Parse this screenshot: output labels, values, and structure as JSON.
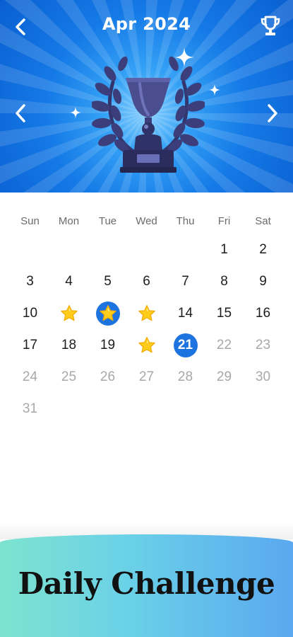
{
  "header": {
    "title": "Apr 2024",
    "back_icon": "chevron-left-icon",
    "trophy_icon": "trophy-icon",
    "prev_icon": "chevron-left-icon",
    "next_icon": "chevron-right-icon"
  },
  "calendar": {
    "weekdays": [
      "Sun",
      "Mon",
      "Tue",
      "Wed",
      "Thu",
      "Fri",
      "Sat"
    ],
    "days": [
      {
        "label": "",
        "state": "blank"
      },
      {
        "label": "",
        "state": "blank"
      },
      {
        "label": "",
        "state": "blank"
      },
      {
        "label": "",
        "state": "blank"
      },
      {
        "label": "",
        "state": "blank"
      },
      {
        "label": "1",
        "state": "normal"
      },
      {
        "label": "2",
        "state": "normal"
      },
      {
        "label": "3",
        "state": "normal"
      },
      {
        "label": "4",
        "state": "normal"
      },
      {
        "label": "5",
        "state": "normal"
      },
      {
        "label": "6",
        "state": "normal"
      },
      {
        "label": "7",
        "state": "normal"
      },
      {
        "label": "8",
        "state": "normal"
      },
      {
        "label": "9",
        "state": "normal"
      },
      {
        "label": "10",
        "state": "normal"
      },
      {
        "label": "",
        "state": "star"
      },
      {
        "label": "",
        "state": "star-selected"
      },
      {
        "label": "",
        "state": "star"
      },
      {
        "label": "14",
        "state": "normal"
      },
      {
        "label": "15",
        "state": "normal"
      },
      {
        "label": "16",
        "state": "normal"
      },
      {
        "label": "17",
        "state": "normal"
      },
      {
        "label": "18",
        "state": "normal"
      },
      {
        "label": "19",
        "state": "normal"
      },
      {
        "label": "",
        "state": "star"
      },
      {
        "label": "21",
        "state": "today"
      },
      {
        "label": "22",
        "state": "future"
      },
      {
        "label": "23",
        "state": "future"
      },
      {
        "label": "24",
        "state": "future"
      },
      {
        "label": "25",
        "state": "future"
      },
      {
        "label": "26",
        "state": "future"
      },
      {
        "label": "27",
        "state": "future"
      },
      {
        "label": "28",
        "state": "future"
      },
      {
        "label": "29",
        "state": "future"
      },
      {
        "label": "30",
        "state": "future"
      },
      {
        "label": "31",
        "state": "future"
      }
    ],
    "colors": {
      "accent": "#1d73e0",
      "star": "#ffcc1a",
      "future": "#a8a8a8"
    }
  },
  "banner": {
    "title": "Daily Challenge"
  }
}
